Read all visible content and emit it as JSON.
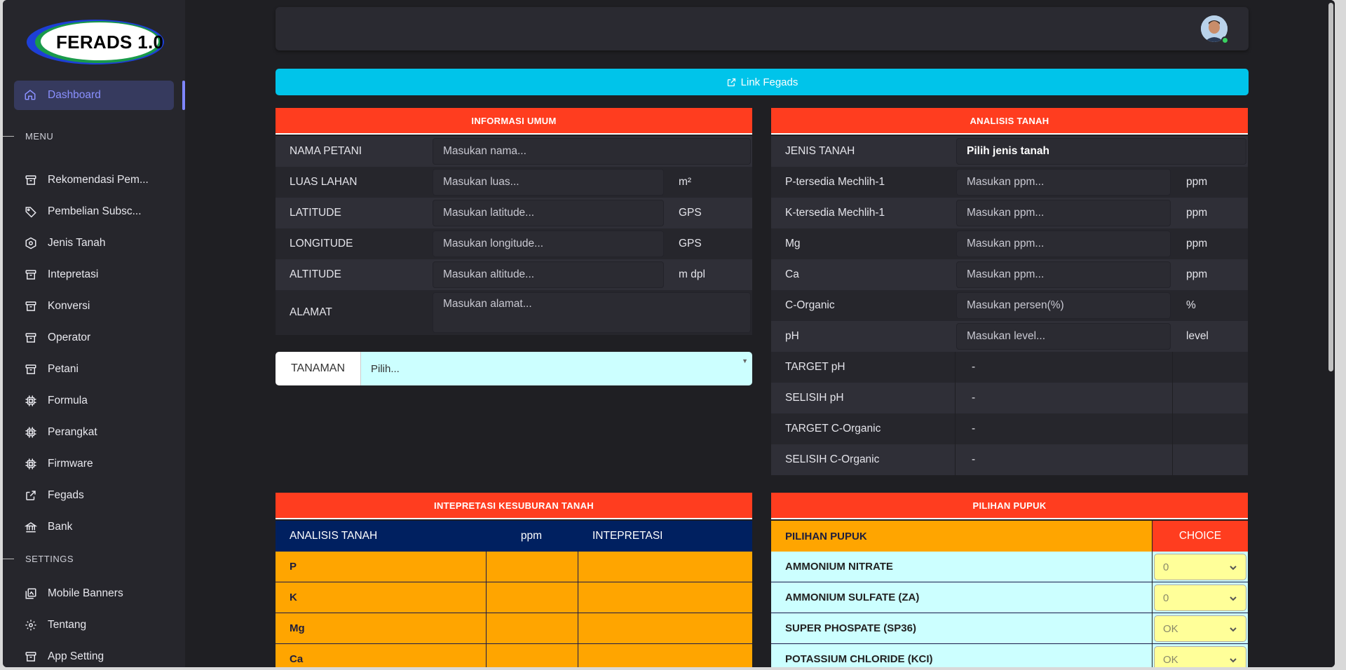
{
  "app": {
    "logo_text": "FERADS 1.0"
  },
  "sidebar": {
    "active": {
      "label": "Dashboard",
      "icon": "home-icon"
    },
    "menu_heading": "MENU",
    "menu_items": [
      {
        "label": "Rekomendasi Pem...",
        "icon": "archive-icon"
      },
      {
        "label": "Pembelian Subsc...",
        "icon": "tag-icon"
      },
      {
        "label": "Jenis Tanah",
        "icon": "hexagon-icon"
      },
      {
        "label": "Intepretasi",
        "icon": "archive-icon"
      },
      {
        "label": "Konversi",
        "icon": "archive-icon"
      },
      {
        "label": "Operator",
        "icon": "archive-icon"
      },
      {
        "label": "Petani",
        "icon": "archive-icon"
      },
      {
        "label": "Formula",
        "icon": "chip-icon"
      },
      {
        "label": "Perangkat",
        "icon": "chip-icon"
      },
      {
        "label": "Firmware",
        "icon": "chip-icon"
      },
      {
        "label": "Fegads",
        "icon": "external-link-icon"
      },
      {
        "label": "Bank",
        "icon": "bank-icon"
      }
    ],
    "settings_heading": "SETTINGS",
    "settings_items": [
      {
        "label": "Mobile Banners",
        "icon": "images-icon"
      },
      {
        "label": "Tentang",
        "icon": "gear-icon"
      },
      {
        "label": "App Setting",
        "icon": "archive-icon"
      }
    ]
  },
  "link_bar": {
    "label": "Link Fegads"
  },
  "info_umum": {
    "title": "INFORMASI UMUM",
    "fields": [
      {
        "label": "NAMA PETANI",
        "placeholder": "Masukan nama...",
        "unit": ""
      },
      {
        "label": "LUAS LAHAN",
        "placeholder": "Masukan luas...",
        "unit": "m²"
      },
      {
        "label": "LATITUDE",
        "placeholder": "Masukan latitude...",
        "unit": "GPS"
      },
      {
        "label": "LONGITUDE",
        "placeholder": "Masukan longitude...",
        "unit": "GPS"
      },
      {
        "label": "ALTITUDE",
        "placeholder": "Masukan altitude...",
        "unit": "m dpl"
      },
      {
        "label": "ALAMAT",
        "placeholder": "Masukan alamat...",
        "unit": ""
      }
    ]
  },
  "tanaman": {
    "label": "TANAMAN",
    "value": "Pilih..."
  },
  "analisis": {
    "title": "ANALISIS TANAH",
    "jenis": {
      "label": "JENIS TANAH",
      "value": "Pilih jenis tanah"
    },
    "fields": [
      {
        "label": "P-tersedia Mechlih-1",
        "placeholder": "Masukan ppm...",
        "unit": "ppm"
      },
      {
        "label": "K-tersedia Mechlih-1",
        "placeholder": "Masukan ppm...",
        "unit": "ppm"
      },
      {
        "label": "Mg",
        "placeholder": "Masukan ppm...",
        "unit": "ppm"
      },
      {
        "label": "Ca",
        "placeholder": "Masukan ppm...",
        "unit": "ppm"
      },
      {
        "label": "C-Organic",
        "placeholder": "Masukan persen(%)",
        "unit": "%"
      },
      {
        "label": "pH",
        "placeholder": "Masukan level...",
        "unit": "level"
      }
    ],
    "results": [
      {
        "label": "TARGET pH",
        "value": "-"
      },
      {
        "label": "SELISIH pH",
        "value": "-"
      },
      {
        "label": "TARGET C-Organic",
        "value": "-"
      },
      {
        "label": "SELISIH C-Organic",
        "value": "-"
      }
    ]
  },
  "intepretasi": {
    "title": "INTEPRETASI KESUBURAN TANAH",
    "headers": [
      "ANALISIS TANAH",
      "ppm",
      "INTEPRETASI"
    ],
    "rows": [
      "P",
      "K",
      "Mg",
      "Ca"
    ],
    "colors": {
      "header": "#002060",
      "row": "#ffa500"
    }
  },
  "pupuk": {
    "title": "PILIHAN PUPUK",
    "header_label": "PILIHAN PUPUK",
    "header_choice": "CHOICE",
    "rows": [
      {
        "name": "AMMONIUM NITRATE",
        "choice": "0"
      },
      {
        "name": "AMMONIUM SULFATE (ZA)",
        "choice": "0"
      },
      {
        "name": "SUPER PHOSPATE (SP36)",
        "choice": "OK"
      },
      {
        "name": "POTASSIUM CHLORIDE (KCI)",
        "choice": "OK"
      }
    ]
  },
  "colors": {
    "accent": "#7f86ff",
    "panel_header": "#ff3d1f",
    "link_bar": "#00c4ea"
  }
}
